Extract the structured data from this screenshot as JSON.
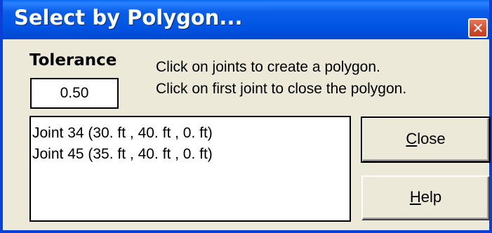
{
  "window": {
    "title": "Select by Polygon...",
    "close_glyph": "✕"
  },
  "tolerance": {
    "label": "Tolerance",
    "value": "0.50"
  },
  "instructions": {
    "line1": "Click on joints to create a polygon.",
    "line2": "Click on first joint to close the polygon."
  },
  "joints": [
    "Joint 34 (30. ft , 40. ft , 0. ft)",
    "Joint 45 (35. ft , 40. ft , 0. ft)"
  ],
  "buttons": {
    "close": {
      "mnemonic": "C",
      "rest": "lose"
    },
    "help": {
      "mnemonic": "H",
      "rest": "elp"
    }
  },
  "colors": {
    "titlebar": "#0054e3",
    "window_face": "#ece9d8",
    "close_button": "#d6492a"
  }
}
